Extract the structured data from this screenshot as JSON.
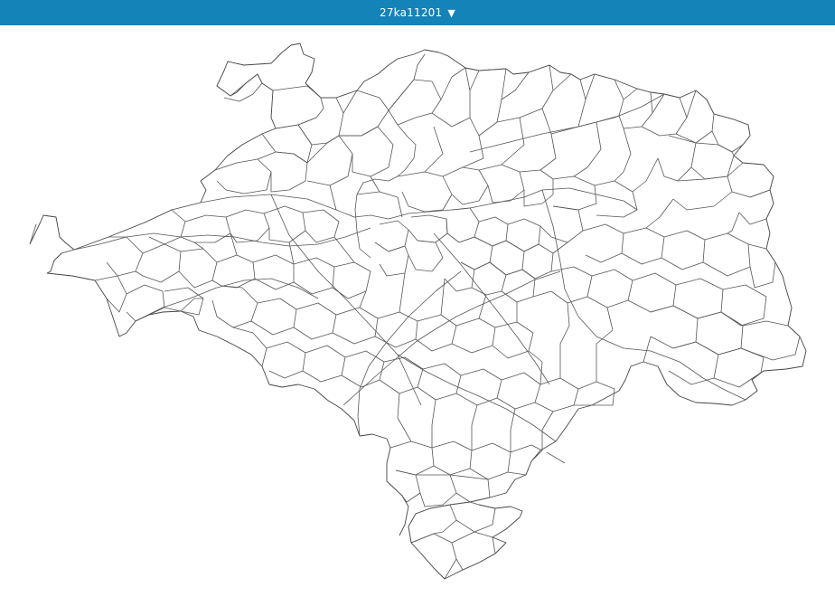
{
  "header": {
    "selected_dataset": "27ka11201",
    "dropdown_icon": "caret-down-icon"
  },
  "map": {
    "style": "white polygons with thin gray boundaries",
    "boundary_color": "#555555",
    "background_color": "#ffffff",
    "bar_color": "#1483b8"
  }
}
